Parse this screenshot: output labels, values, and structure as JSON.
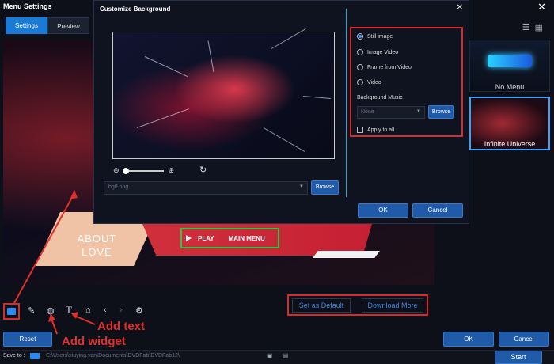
{
  "window": {
    "title": "Menu Settings",
    "close": "✕"
  },
  "tabs": [
    {
      "label": "Settings",
      "active": true
    },
    {
      "label": "Preview",
      "active": false
    }
  ],
  "menu_template": {
    "about_line1": "ABOUT",
    "about_line2": "LOVE",
    "play_label": "PLAY",
    "main_menu_label": "MAIN MENU"
  },
  "templates": [
    {
      "label": "No Menu"
    },
    {
      "label": "Infinite Universe",
      "selected": true
    }
  ],
  "dialog": {
    "title": "Customize Background",
    "close": "✕",
    "file_value": "bg0.png",
    "browse_label": "Browse",
    "options": [
      {
        "label": "Still image",
        "selected": true
      },
      {
        "label": "Image Video",
        "selected": false
      },
      {
        "label": "Frame from Video",
        "selected": false
      },
      {
        "label": "Video",
        "selected": false
      }
    ],
    "music_label": "Background Music",
    "music_value": "None",
    "music_browse": "Browse",
    "apply_all": "Apply to all",
    "ok": "OK",
    "cancel": "Cancel"
  },
  "toolbar": {
    "set_default": "Set as Default",
    "download_more": "Download More"
  },
  "buttons": {
    "reset": "Reset",
    "ok": "OK",
    "cancel": "Cancel",
    "start": "Start"
  },
  "annotations": {
    "add_text": "Add text",
    "add_widget": "Add widget"
  },
  "save": {
    "label": "Save to :",
    "path": "C:\\Users\\xiuying.yan\\Documents\\DVDFab\\DVDFab12\\"
  },
  "colors": {
    "accent": "#1a7bd6",
    "highlight_red": "#d82a2a",
    "highlight_green": "#35c24a"
  }
}
